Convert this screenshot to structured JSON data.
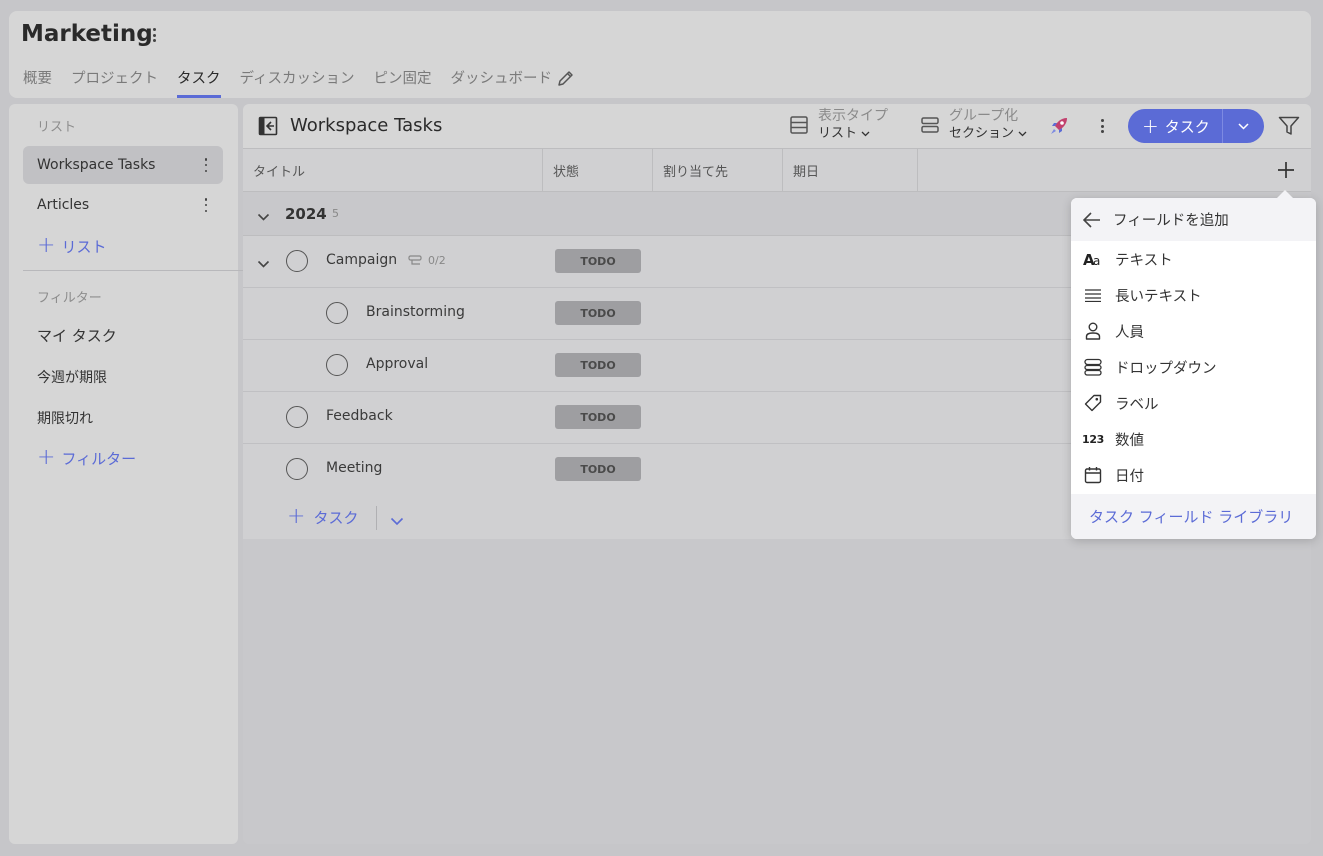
{
  "workspace": {
    "title": "Marketing"
  },
  "tabs": [
    {
      "label": "概要"
    },
    {
      "label": "プロジェクト"
    },
    {
      "label": "タスク"
    },
    {
      "label": "ディスカッション"
    },
    {
      "label": "ピン固定"
    },
    {
      "label": "ダッシュボード"
    }
  ],
  "sidebar": {
    "lists_label": "リスト",
    "lists": [
      {
        "label": "Workspace Tasks"
      },
      {
        "label": "Articles"
      }
    ],
    "add_list": "リスト",
    "filters_label": "フィルター",
    "filters": [
      {
        "label": "マイ タスク"
      },
      {
        "label": "今週が期限"
      },
      {
        "label": "期限切れ"
      }
    ],
    "add_filter": "フィルター"
  },
  "toolbar": {
    "title": "Workspace Tasks",
    "view_type_label": "表示タイプ",
    "view_type_value": "リスト",
    "group_label": "グループ化",
    "group_value": "セクション",
    "add_task": "タスク"
  },
  "columns": {
    "title": "タイトル",
    "status": "状態",
    "assignee": "割り当て先",
    "due": "期日"
  },
  "group": {
    "title": "2024",
    "count": "5"
  },
  "tasks": [
    {
      "name": "Campaign",
      "status": "TODO",
      "subtasks": "0/2"
    },
    {
      "name": "Brainstorming",
      "status": "TODO"
    },
    {
      "name": "Approval",
      "status": "TODO"
    },
    {
      "name": "Feedback",
      "status": "TODO"
    },
    {
      "name": "Meeting",
      "status": "TODO"
    }
  ],
  "add_row": {
    "label": "タスク"
  },
  "popover": {
    "title": "フィールドを追加",
    "items": [
      {
        "label": "テキスト",
        "icon": "text-aa-icon"
      },
      {
        "label": "長いテキスト",
        "icon": "long-text-icon"
      },
      {
        "label": "人員",
        "icon": "person-icon"
      },
      {
        "label": "ドロップダウン",
        "icon": "dropdown-icon"
      },
      {
        "label": "ラベル",
        "icon": "tag-icon"
      },
      {
        "label": "数値",
        "icon": "number-icon",
        "glyph": "123"
      },
      {
        "label": "日付",
        "icon": "calendar-icon"
      }
    ],
    "footer": "タスク フィールド ライブラリ"
  },
  "colors": {
    "accent": "#5b6bd6",
    "status_bg": "#9e9ea1"
  }
}
